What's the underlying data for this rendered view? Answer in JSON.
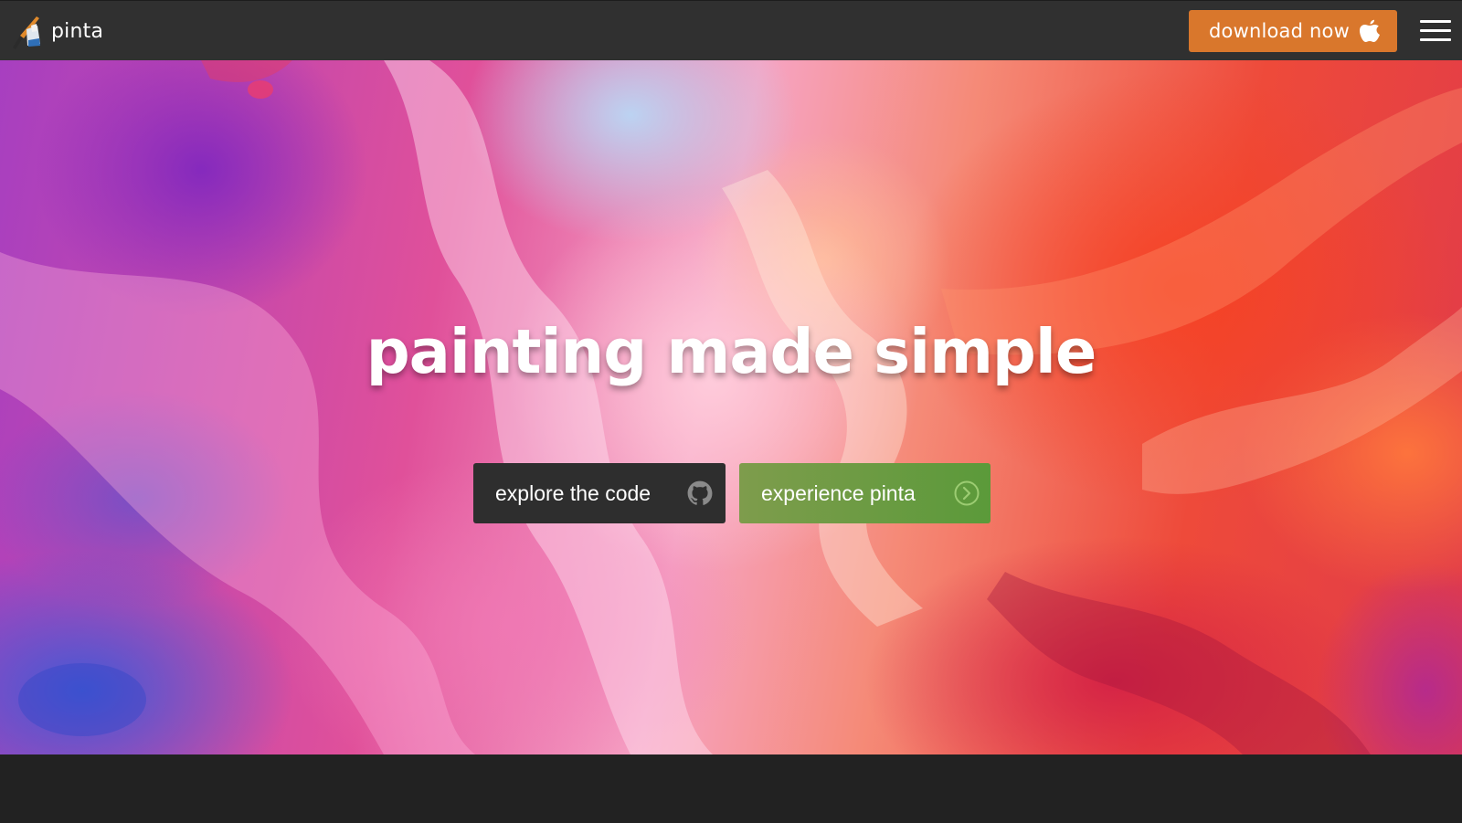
{
  "navbar": {
    "brand_name": "pinta",
    "download_label": "download now",
    "download_color": "#d9772c",
    "logo_icon": "pinta-logo-icon",
    "platform_icon": "apple-icon",
    "menu_icon": "hamburger-menu-icon"
  },
  "hero": {
    "title": "painting made simple",
    "buttons": [
      {
        "label": "explore the code",
        "icon": "github-icon",
        "color": "#2e2e2e"
      },
      {
        "label": "experience pinta",
        "icon": "chevron-right-circle-icon",
        "color": "#5b9a3a"
      }
    ]
  }
}
